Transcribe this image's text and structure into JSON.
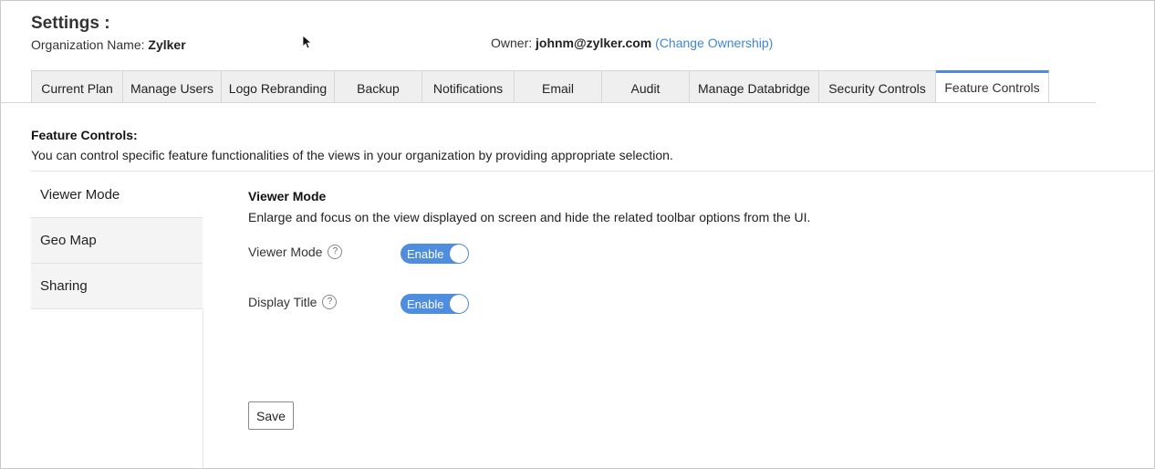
{
  "header": {
    "title": "Settings :",
    "org_label": "Organization Name:",
    "org_name": "Zylker",
    "owner_label": "Owner:",
    "owner_email": "johnm@zylker.com",
    "change_ownership": "(Change Ownership)"
  },
  "tabs": [
    {
      "label": "Current Plan"
    },
    {
      "label": "Manage Users"
    },
    {
      "label": "Logo Rebranding"
    },
    {
      "label": "Backup"
    },
    {
      "label": "Notifications"
    },
    {
      "label": "Email"
    },
    {
      "label": "Audit"
    },
    {
      "label": "Manage Databridge"
    },
    {
      "label": "Security Controls"
    },
    {
      "label": "Feature Controls",
      "active": true
    }
  ],
  "section": {
    "title": "Feature Controls:",
    "description": "You can control specific feature functionalities of the views in your organization by providing appropriate selection."
  },
  "sidebar": {
    "items": [
      {
        "label": "Viewer Mode",
        "active": true
      },
      {
        "label": "Geo Map"
      },
      {
        "label": "Sharing"
      }
    ]
  },
  "panel": {
    "title": "Viewer Mode",
    "description": "Enlarge and focus on the view displayed on screen and hide the related toolbar options from the UI.",
    "settings": [
      {
        "label": "Viewer Mode",
        "toggle_text": "Enable",
        "enabled": true
      },
      {
        "label": "Display Title",
        "toggle_text": "Enable",
        "enabled": true
      }
    ],
    "save_label": "Save"
  },
  "colors": {
    "accent": "#4f8ddf",
    "link": "#3f86d6"
  }
}
